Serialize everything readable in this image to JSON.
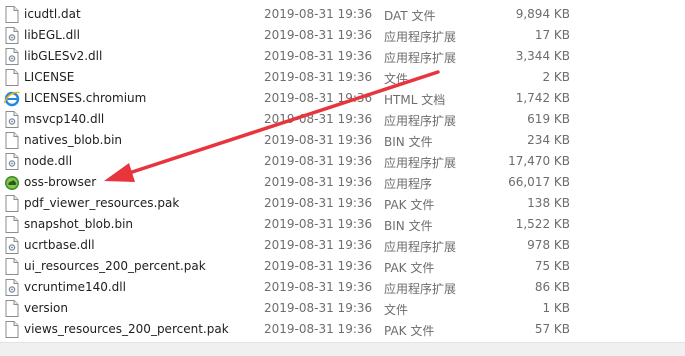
{
  "files": [
    {
      "name": "icudtl.dat",
      "date": "2019-08-31 19:36",
      "type": "DAT 文件",
      "size": "9,894 KB",
      "icon": "file-icon"
    },
    {
      "name": "libEGL.dll",
      "date": "2019-08-31 19:36",
      "type": "应用程序扩展",
      "size": "17 KB",
      "icon": "dll-file-icon"
    },
    {
      "name": "libGLESv2.dll",
      "date": "2019-08-31 19:36",
      "type": "应用程序扩展",
      "size": "3,344 KB",
      "icon": "dll-file-icon"
    },
    {
      "name": "LICENSE",
      "date": "2019-08-31 19:36",
      "type": "文件",
      "size": "2 KB",
      "icon": "file-icon"
    },
    {
      "name": "LICENSES.chromium",
      "date": "2019-08-31 19:36",
      "type": "HTML 文档",
      "size": "1,742 KB",
      "icon": "ie-html-icon"
    },
    {
      "name": "msvcp140.dll",
      "date": "2019-08-31 19:36",
      "type": "应用程序扩展",
      "size": "619 KB",
      "icon": "dll-file-icon"
    },
    {
      "name": "natives_blob.bin",
      "date": "2019-08-31 19:36",
      "type": "BIN 文件",
      "size": "234 KB",
      "icon": "file-icon"
    },
    {
      "name": "node.dll",
      "date": "2019-08-31 19:36",
      "type": "应用程序扩展",
      "size": "17,470 KB",
      "icon": "dll-file-icon"
    },
    {
      "name": "oss-browser",
      "date": "2019-08-31 19:36",
      "type": "应用程序",
      "size": "66,017 KB",
      "icon": "oss-browser-app-icon"
    },
    {
      "name": "pdf_viewer_resources.pak",
      "date": "2019-08-31 19:36",
      "type": "PAK 文件",
      "size": "138 KB",
      "icon": "file-icon"
    },
    {
      "name": "snapshot_blob.bin",
      "date": "2019-08-31 19:36",
      "type": "BIN 文件",
      "size": "1,522 KB",
      "icon": "file-icon"
    },
    {
      "name": "ucrtbase.dll",
      "date": "2019-08-31 19:36",
      "type": "应用程序扩展",
      "size": "978 KB",
      "icon": "dll-file-icon"
    },
    {
      "name": "ui_resources_200_percent.pak",
      "date": "2019-08-31 19:36",
      "type": "PAK 文件",
      "size": "75 KB",
      "icon": "file-icon"
    },
    {
      "name": "vcruntime140.dll",
      "date": "2019-08-31 19:36",
      "type": "应用程序扩展",
      "size": "86 KB",
      "icon": "dll-file-icon"
    },
    {
      "name": "version",
      "date": "2019-08-31 19:36",
      "type": "文件",
      "size": "1 KB",
      "icon": "file-icon"
    },
    {
      "name": "views_resources_200_percent.pak",
      "date": "2019-08-31 19:36",
      "type": "PAK 文件",
      "size": "57 KB",
      "icon": "file-icon"
    }
  ],
  "annotation": {
    "type": "arrow",
    "color": "#e8343c",
    "points_to": "oss-browser"
  },
  "colors": {
    "secondary_text": "#6d6d6d",
    "primary_text": "#1e1e1e",
    "arrow": "#e8343c"
  }
}
